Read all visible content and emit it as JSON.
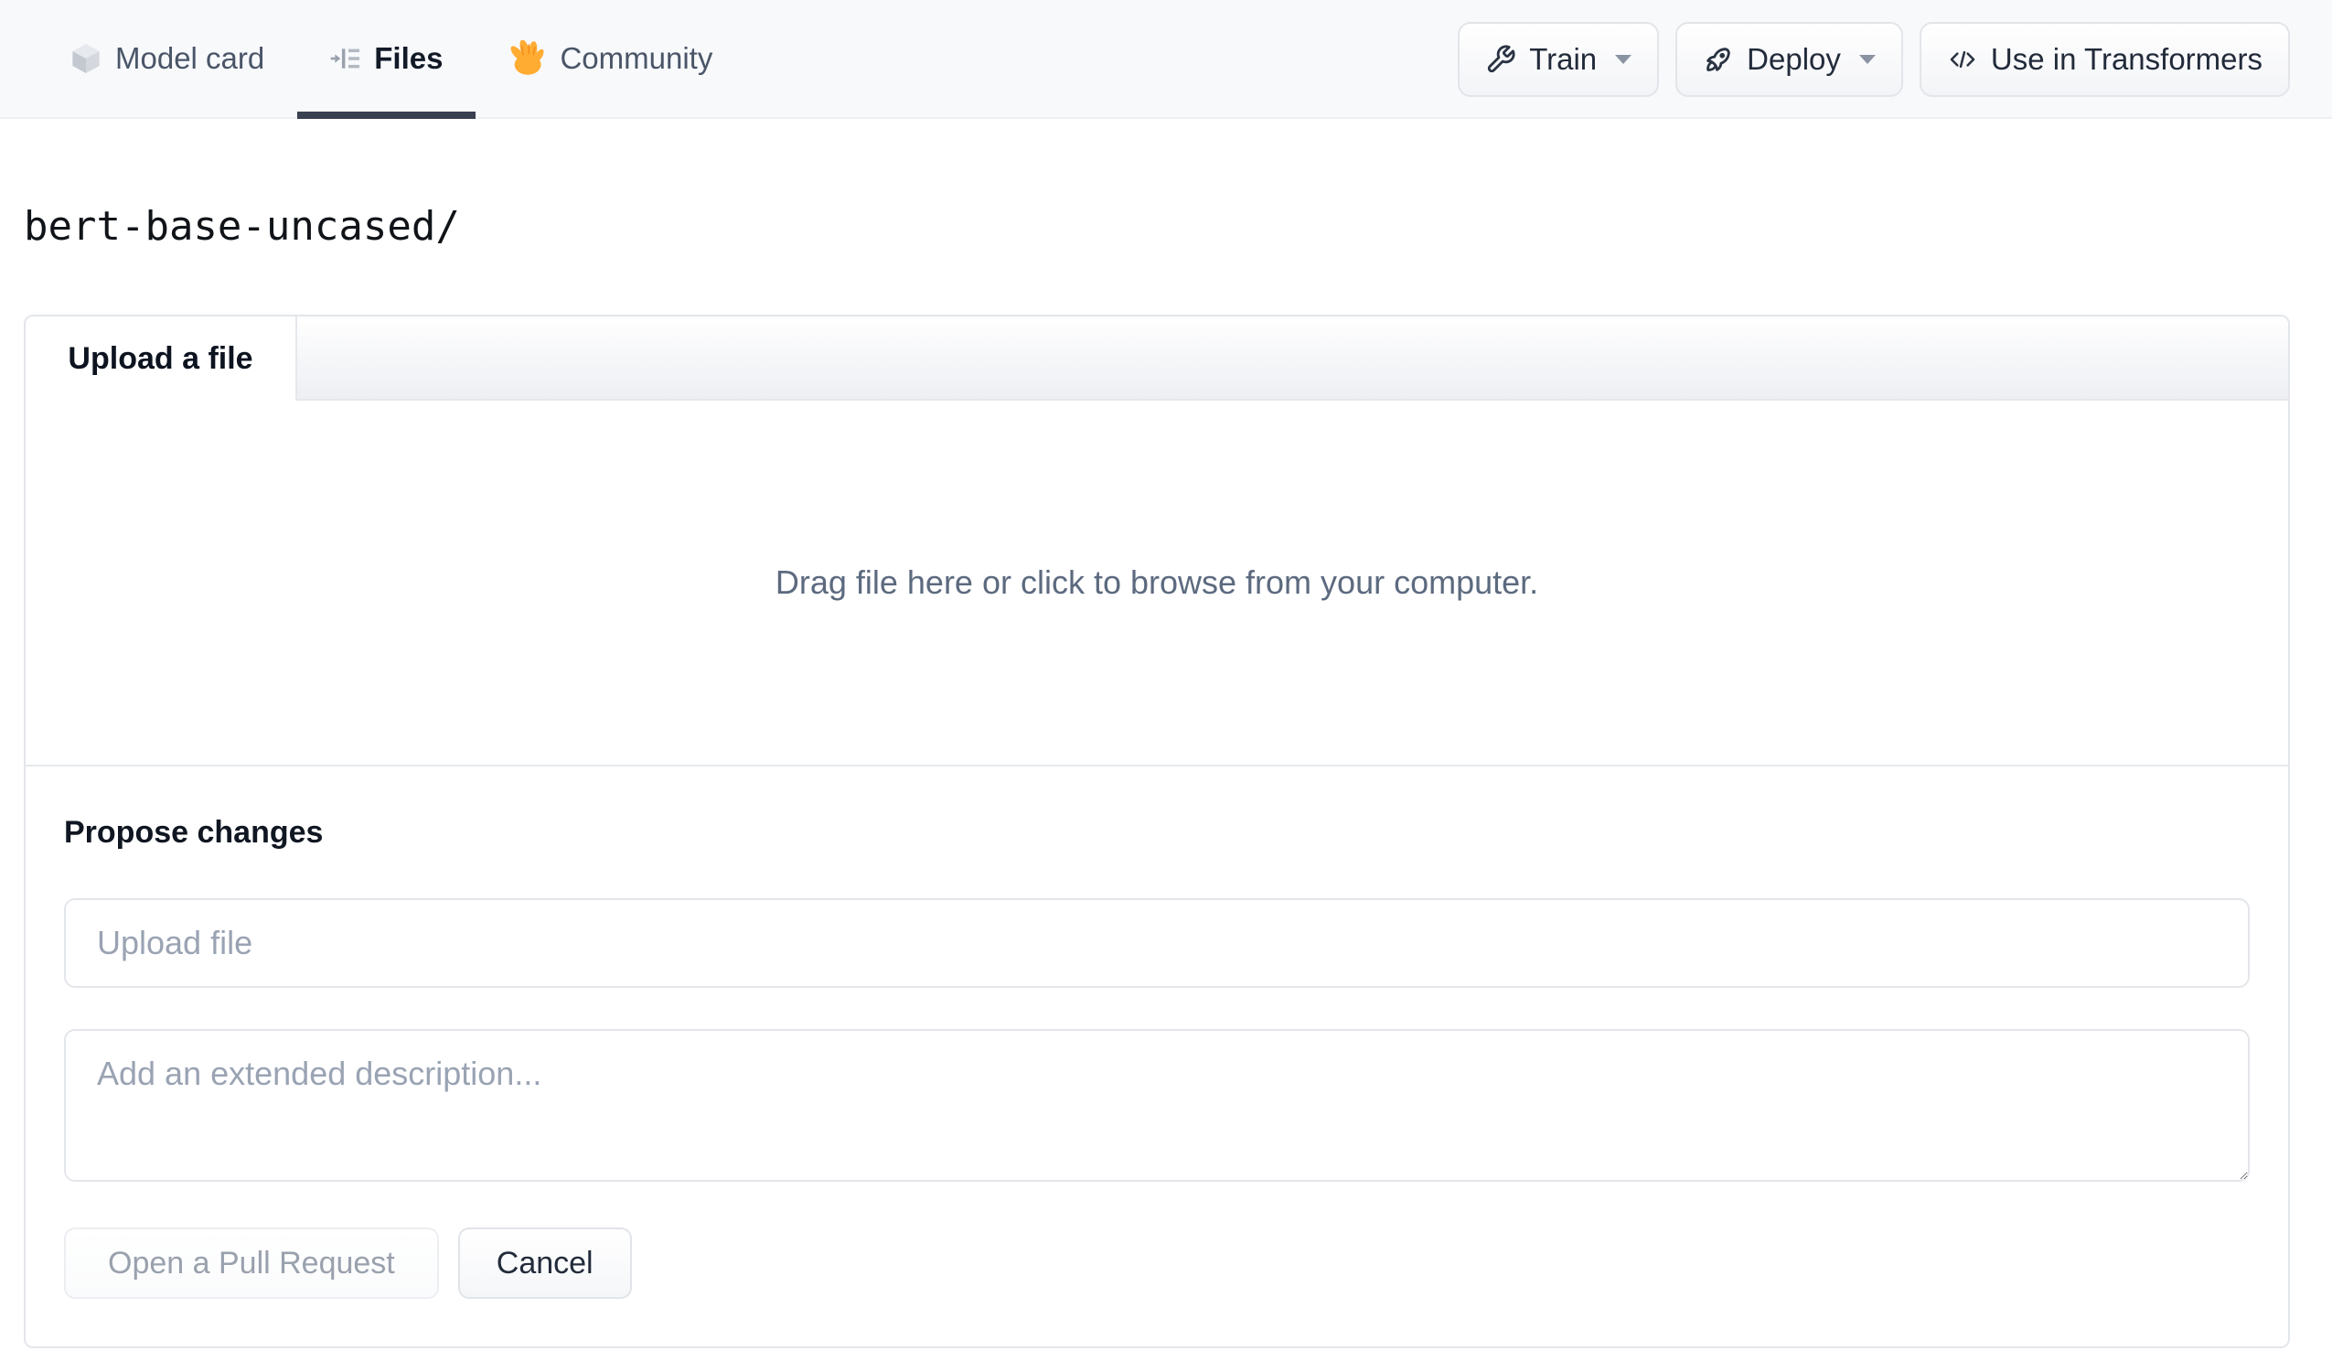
{
  "header": {
    "tabs": [
      {
        "label": "Model card",
        "icon": "cube-icon",
        "active": false
      },
      {
        "label": "Files",
        "icon": "file-versions-icon",
        "active": true
      },
      {
        "label": "Community",
        "icon": "waving-hand-icon",
        "active": false
      }
    ],
    "actions": [
      {
        "label": "Train",
        "icon": "wrench-icon",
        "has_dropdown": true
      },
      {
        "label": "Deploy",
        "icon": "rocket-icon",
        "has_dropdown": true
      },
      {
        "label": "Use in Transformers",
        "icon": "code-icon",
        "has_dropdown": false
      }
    ]
  },
  "breadcrumb": {
    "path": "bert-base-uncased/"
  },
  "upload_panel": {
    "tab_label": "Upload a file",
    "dropzone_text": "Drag file here or click to browse from your computer.",
    "propose": {
      "heading": "Propose changes",
      "filename_placeholder": "Upload file",
      "description_placeholder": "Add an extended description...",
      "primary_button_label": "Open a Pull Request",
      "cancel_button_label": "Cancel"
    }
  },
  "colors": {
    "header_background": "#f8f9fb",
    "active_tab_underline": "#394050",
    "panel_border": "#e3e6ea",
    "muted_text": "#5c6a7f",
    "placeholder_text": "#9aa3b3",
    "disabled_button_text": "#99a1ad"
  }
}
